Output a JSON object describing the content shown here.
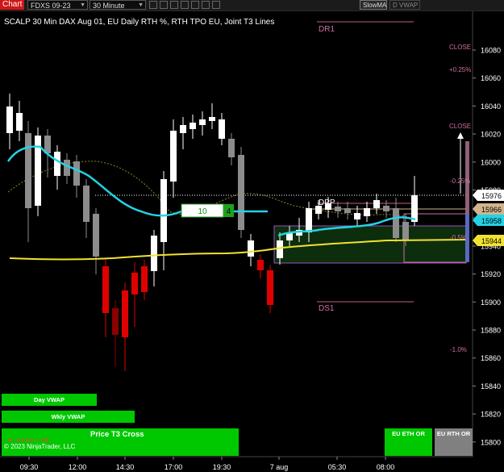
{
  "toolbar": {
    "chart_tab": "Chart",
    "instrument": "FDXS 09-23",
    "interval": "30 Minute",
    "slowma_button": "SlowMA",
    "dvwap_button": "D VWAP"
  },
  "chart_title": "SCALP 30 Min DAX Aug 01, EU Daily RTH %, RTH TPO EU, Joint T3 Lines",
  "levels": {
    "dr1": "DR1",
    "ds1": "DS1",
    "dpp": "DPP",
    "close_top": "CLOSE",
    "close_mid": "CLOSE",
    "pct_plus_025": "+0.25%",
    "pct_minus_025": "-0.25%",
    "pct_minus_05": "-0.5%",
    "pct_minus_1": "-1.0%"
  },
  "price_axis": {
    "ticks": [
      "16080",
      "16060",
      "16040",
      "16020",
      "16000",
      "15980",
      "15960",
      "15940",
      "15920",
      "15900",
      "15880",
      "15860",
      "15840",
      "15820",
      "15800"
    ],
    "markers": {
      "current": "15976",
      "tan": "15966",
      "cyan": "15958",
      "yellow": "15944"
    }
  },
  "time_axis": [
    "09:30",
    "12:00",
    "14:30",
    "17:00",
    "19:30",
    "7 aug",
    "05:30",
    "08:00"
  ],
  "box_labels": {
    "green_count": "10",
    "dark_count": "4"
  },
  "panel_buttons": {
    "day_vwap": "Day VWAP",
    "wkly_vwap": "Wkly VWAP",
    "price_t3_cross": "Price T3 Cross",
    "eu_eth_or": "EU ETH OR",
    "eu_rth_or": "EU RTH OR"
  },
  "d_readout": "D -0.31% = -49",
  "copyright": "© 2023 NinjaTrader, LLC",
  "colors": {
    "up_candle": "#ffffff",
    "neutral_candle": "#8c8c8c",
    "down_candle": "#e00000",
    "dark_down_candle": "#8b0000",
    "cyan_line": "#22d3e6",
    "yellow_line": "#f2e230",
    "green_button": "#00c800",
    "chart_tab": "#d01616"
  }
}
